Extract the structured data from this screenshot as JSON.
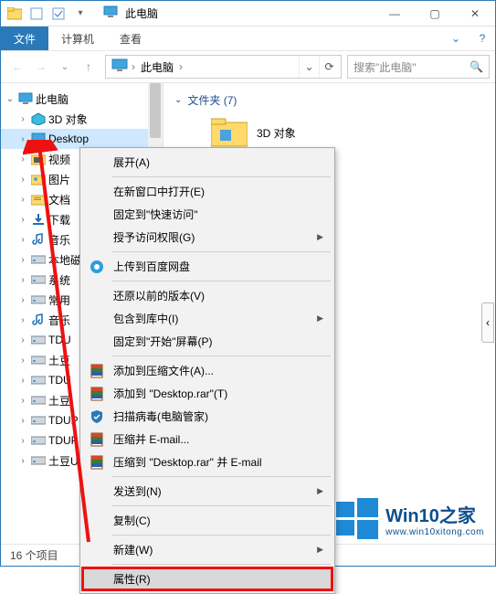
{
  "titlebar": {
    "title": "此电脑"
  },
  "window_buttons": {
    "min": "—",
    "max": "▢",
    "close": "✕"
  },
  "ribbon": {
    "file": "文件",
    "computer": "计算机",
    "view": "查看",
    "expand_icon": "⌄",
    "help_icon": "?"
  },
  "nav": {
    "back": "←",
    "forward": "→",
    "recent": "⌄",
    "up": "↑",
    "crumb_root": "此电脑",
    "crumb_chev": "›",
    "dd": "⌄",
    "refresh": "⟳"
  },
  "search": {
    "placeholder": "搜索\"此电脑\"",
    "icon": "🔍"
  },
  "tree": {
    "root": "此电脑",
    "items": [
      "3D 对象",
      "Desktop",
      "视频",
      "图片",
      "文档",
      "下载",
      "音乐",
      "本地磁盘",
      "系统",
      "常用",
      "音乐",
      "TDU",
      "土豆",
      "TDU",
      "土豆",
      "TDUP",
      "TDUP",
      "土豆U"
    ]
  },
  "main": {
    "group_label": "文件夹 (7)",
    "folder_label": "3D 对象"
  },
  "context_menu": {
    "items": [
      {
        "label": "展开(A)",
        "sub": false
      },
      null,
      {
        "label": "在新窗口中打开(E)",
        "sub": false
      },
      {
        "label": "固定到\"快速访问\"",
        "sub": false
      },
      {
        "label": "授予访问权限(G)",
        "sub": true
      },
      null,
      {
        "label": "上传到百度网盘",
        "icon": "baidu"
      },
      null,
      {
        "label": "还原以前的版本(V)",
        "sub": false
      },
      {
        "label": "包含到库中(I)",
        "sub": true
      },
      {
        "label": "固定到\"开始\"屏幕(P)",
        "sub": false
      },
      null,
      {
        "label": "添加到压缩文件(A)...",
        "icon": "rar"
      },
      {
        "label": "添加到 \"Desktop.rar\"(T)",
        "icon": "rar"
      },
      {
        "label": "扫描病毒(电脑管家)",
        "icon": "shield"
      },
      {
        "label": "压缩并 E-mail...",
        "icon": "rar"
      },
      {
        "label": "压缩到 \"Desktop.rar\" 并 E-mail",
        "icon": "rar"
      },
      null,
      {
        "label": "发送到(N)",
        "sub": true
      },
      null,
      {
        "label": "复制(C)",
        "sub": false
      },
      null,
      {
        "label": "新建(W)",
        "sub": true
      },
      null,
      {
        "label": "属性(R)",
        "sub": false,
        "highlight": true,
        "framed": true
      }
    ]
  },
  "statusbar": {
    "text": "16 个项目"
  },
  "watermark": {
    "big": "Win10之家",
    "small": "www.win10xitong.com"
  },
  "side_handle": "‹"
}
